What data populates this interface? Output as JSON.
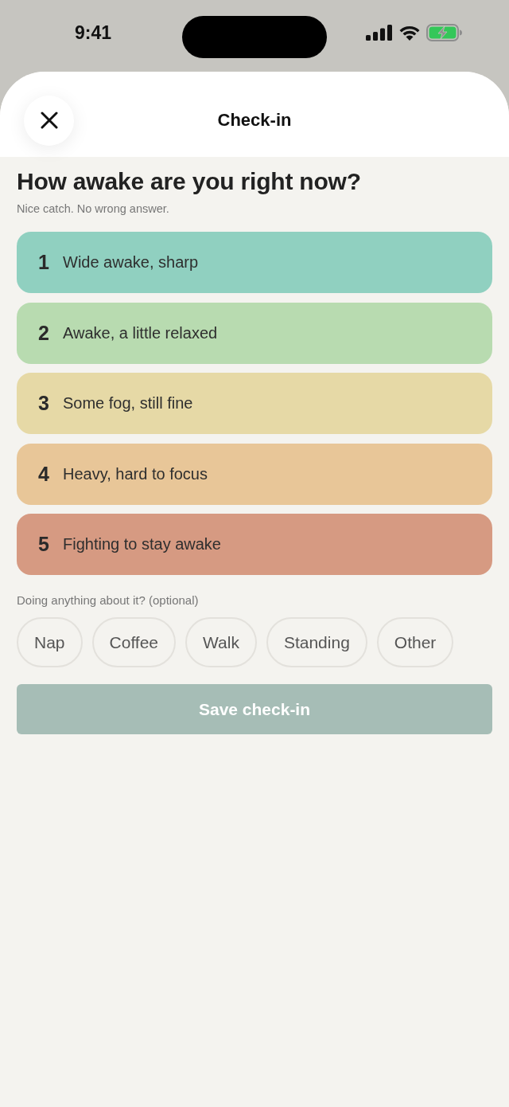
{
  "status_bar": {
    "time": "9:41"
  },
  "header": {
    "title": "Check-in"
  },
  "question": {
    "title": "How awake are you right now?",
    "subtitle": "Nice catch. No wrong answer."
  },
  "options": [
    {
      "number": "1",
      "label": "Wide awake, sharp",
      "color": "#90d0c0",
      "selected": false
    },
    {
      "number": "2",
      "label": "Awake, a little relaxed",
      "color": "#b8dbb0",
      "selected": false
    },
    {
      "number": "3",
      "label": "Some fog, still fine",
      "color": "#e6d9a6",
      "selected": false
    },
    {
      "number": "4",
      "label": "Heavy, hard to focus",
      "color": "#e8c698",
      "selected": false
    },
    {
      "number": "5",
      "label": "Fighting to stay awake",
      "color": "#d69a82",
      "selected": false
    }
  ],
  "actions": {
    "label": "Doing anything about it? (optional)",
    "chips": [
      {
        "label": "Nap",
        "selected": false
      },
      {
        "label": "Coffee",
        "selected": false
      },
      {
        "label": "Walk",
        "selected": false
      },
      {
        "label": "Standing",
        "selected": false
      },
      {
        "label": "Other",
        "selected": false
      }
    ]
  },
  "save_button": {
    "label": "Save check-in",
    "disabled": true
  }
}
